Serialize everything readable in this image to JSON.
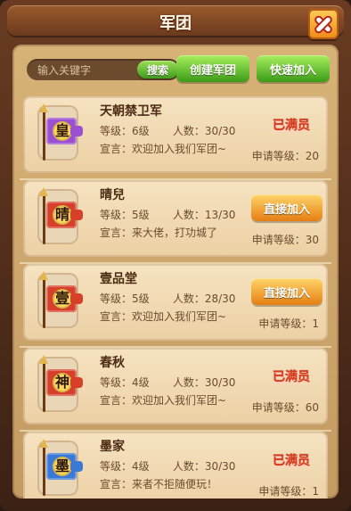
{
  "window": {
    "title": "军团"
  },
  "search": {
    "placeholder": "输入关键字",
    "button": "搜索"
  },
  "actions": {
    "create": "创建军团",
    "quick_join": "快速加入"
  },
  "labels": {
    "level_prefix": "等级：",
    "members_prefix": "人数：",
    "declaration_prefix": "宣言：",
    "req_prefix": "申请等级："
  },
  "legions": [
    {
      "name": "天朝禁卫军",
      "emblem_char": "皇",
      "emblem_color": "#9b4fd1",
      "level": "6级",
      "members": "30/30",
      "declaration": "欢迎加入我们军团~",
      "status": "已满员",
      "req_level": "20"
    },
    {
      "name": "晴兒",
      "emblem_char": "晴",
      "emblem_color": "#d6402a",
      "level": "5级",
      "members": "13/30",
      "declaration": "来大佬，打功城了",
      "action": "直接加入",
      "req_level": "30"
    },
    {
      "name": "壹品堂",
      "emblem_char": "壹",
      "emblem_color": "#d6402a",
      "level": "5级",
      "members": "28/30",
      "declaration": "欢迎加入我们军团~",
      "action": "直接加入",
      "req_level": "1"
    },
    {
      "name": "春秋",
      "emblem_char": "神",
      "emblem_color": "#d6402a",
      "level": "4级",
      "members": "30/30",
      "declaration": "欢迎加入我们军团~",
      "status": "已满员",
      "req_level": "60"
    },
    {
      "name": "墨家",
      "emblem_char": "墨",
      "emblem_color": "#3b79d6",
      "level": "4级",
      "members": "30/30",
      "declaration": "来者不拒随便玩！",
      "status": "已满员",
      "req_level": "1"
    }
  ]
}
